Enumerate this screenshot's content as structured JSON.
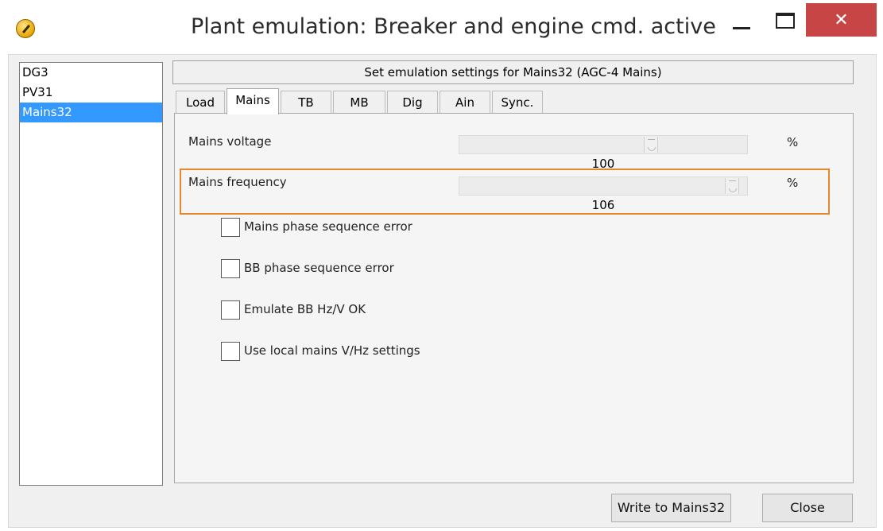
{
  "window": {
    "title": "Plant emulation: Breaker and engine cmd. active",
    "close_glyph": "✕"
  },
  "units": [
    "DG3",
    "PV31",
    "Mains32"
  ],
  "selected_unit": "Mains32",
  "header": "Set emulation settings for Mains32 (AGC-4 Mains)",
  "tabs": [
    "Load",
    "Mains",
    "TB",
    "MB",
    "Dig",
    "Ain",
    "Sync."
  ],
  "active_tab": "Mains",
  "settings": {
    "voltage": {
      "label": "Mains voltage",
      "value": "100",
      "unit": "%"
    },
    "frequency": {
      "label": "Mains frequency",
      "value": "106",
      "unit": "%"
    }
  },
  "checkboxes": [
    {
      "label": "Mains phase sequence error",
      "checked": false
    },
    {
      "label": "BB phase sequence error",
      "checked": false
    },
    {
      "label": "Emulate BB Hz/V OK",
      "checked": false
    },
    {
      "label": "Use local mains V/Hz settings",
      "checked": false
    }
  ],
  "buttons": {
    "write": "Write to Mains32",
    "close": "Close"
  },
  "colors": {
    "highlight": "#e8862c",
    "selection": "#3399ff",
    "close_button": "#c74545"
  }
}
